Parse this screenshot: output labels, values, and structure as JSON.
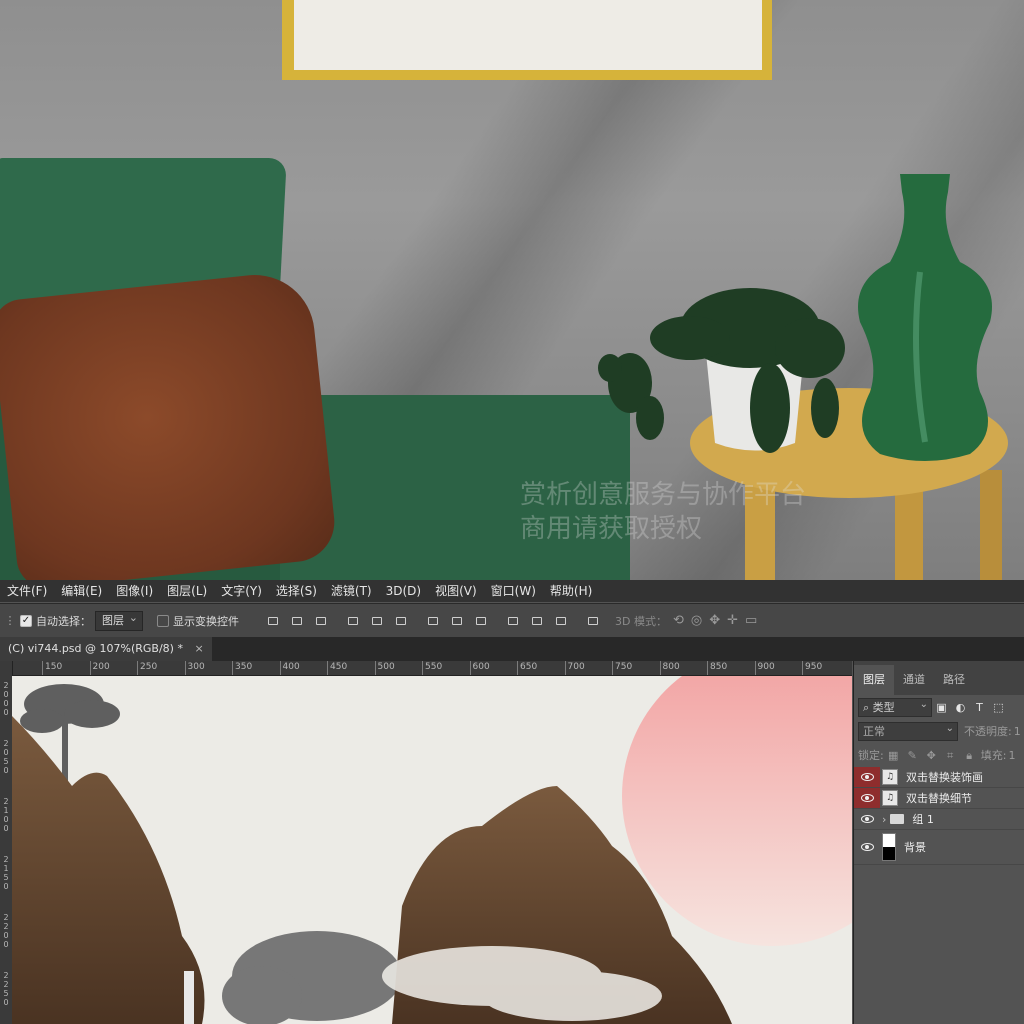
{
  "photo": {
    "watermark_line1": "赏析创意服务与协作平台",
    "watermark_line2": "商用请获取授权"
  },
  "menubar": {
    "items": [
      "文件(F)",
      "编辑(E)",
      "图像(I)",
      "图层(L)",
      "文字(Y)",
      "选择(S)",
      "滤镜(T)",
      "3D(D)",
      "视图(V)",
      "窗口(W)",
      "帮助(H)"
    ]
  },
  "options_bar": {
    "auto_select_label": "自动选择：",
    "auto_select_checked": true,
    "target_value": "图层",
    "show_transform_label": "显示变换控件",
    "show_transform_checked": false,
    "mode_3d_label": "3D 模式："
  },
  "document_tab": {
    "title": "(C) vi744.psd @ 107%(RGB/8) *",
    "close_label": "×"
  },
  "ruler": {
    "h_ticks": [
      "150",
      "200",
      "250",
      "300",
      "350",
      "400",
      "450",
      "500",
      "550",
      "600",
      "650",
      "700",
      "750",
      "800",
      "850",
      "900",
      "950"
    ],
    "v_ticks": [
      "2000",
      "2050",
      "2100",
      "2150",
      "2200",
      "2250"
    ]
  },
  "layers_panel": {
    "tabs": [
      "图层",
      "通道",
      "路径"
    ],
    "active_tab": 0,
    "filter_label": "类型",
    "blend_mode": "正常",
    "opacity_label": "不透明度:",
    "opacity_value": "1",
    "lock_label": "锁定:",
    "fill_label": "填充:",
    "fill_value": "1",
    "layers": [
      {
        "name": "双击替换装饰画",
        "kind": "smart-object",
        "visible": true,
        "eye_highlight": true
      },
      {
        "name": "双击替换细节",
        "kind": "smart-object",
        "visible": true,
        "eye_highlight": true
      },
      {
        "name": "组 1",
        "kind": "group",
        "visible": true,
        "eye_highlight": false
      },
      {
        "name": "背景",
        "kind": "background",
        "visible": true,
        "eye_highlight": false
      }
    ]
  },
  "colors": {
    "sun_top": "#f2a0a0",
    "canvas_bg": "#ecebe6",
    "eye_highlight": "#8e2d2d"
  }
}
